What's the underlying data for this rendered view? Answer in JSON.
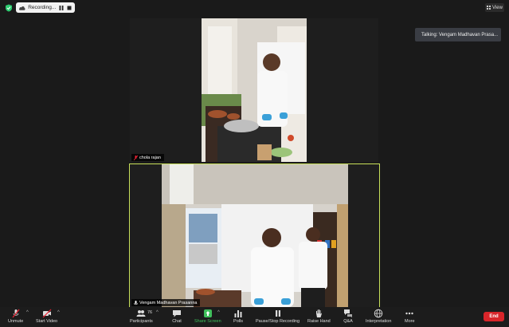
{
  "top_bar": {
    "recording_label": "Recording...",
    "view_label": "View"
  },
  "talking": "Talking: Vengam Madhavan Prasa...",
  "tiles": [
    {
      "name": "chola rajan"
    },
    {
      "name": "Vengam Madhavan Prasanna"
    }
  ],
  "toolbar": {
    "unmute": "Unmute",
    "start_video": "Start Video",
    "participants": "Participants",
    "participant_count": "76",
    "chat": "Chat",
    "share_screen": "Share Screen",
    "polls": "Polls",
    "pause_stop_recording": "Pause/Stop Recording",
    "raise_hand": "Raise Hand",
    "qa": "Q&A",
    "interpretation": "Interpretation",
    "more": "More",
    "end": "End"
  },
  "colors": {
    "active_speaker_border": "#c8e05a",
    "share_green": "#3fbf5b",
    "end_red": "#d9252a"
  }
}
